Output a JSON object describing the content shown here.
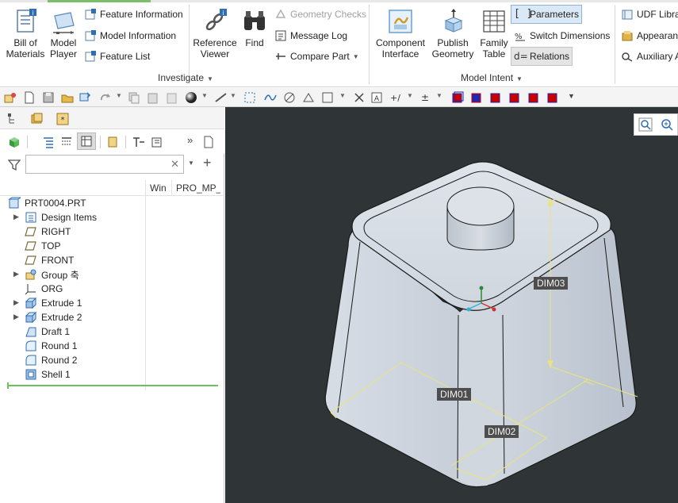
{
  "ribbon": {
    "bom": {
      "line1": "Bill of",
      "line2": "Materials"
    },
    "model_player": {
      "line1": "Model",
      "line2": "Player"
    },
    "feature_information": "Feature Information",
    "model_information": "Model Information",
    "feature_list": "Feature List",
    "reference_viewer": {
      "line1": "Reference",
      "line2": "Viewer"
    },
    "find": "Find",
    "geometry_checks": "Geometry Checks",
    "message_log": "Message Log",
    "compare_part": "Compare Part",
    "investigate_label": "Investigate",
    "component_interface": {
      "line1": "Component",
      "line2": "Interface"
    },
    "publish_geometry": {
      "line1": "Publish",
      "line2": "Geometry"
    },
    "family_table": {
      "line1": "Family",
      "line2": "Table"
    },
    "parameters": "Parameters",
    "switch_dimensions": "Switch Dimensions",
    "relations": "Relations",
    "model_intent_label": "Model Intent",
    "udf_library": "UDF Libra",
    "appearance": "Appearan",
    "auxiliary": "Auxiliary A"
  },
  "panel": {
    "filter_placeholder": "",
    "columns": [
      "Win",
      "PRO_MP_"
    ],
    "tree": [
      {
        "label": "PRT0004.PRT",
        "icon": "part-icon",
        "expandable": false,
        "level": 0
      },
      {
        "label": "Design Items",
        "icon": "design-items-icon",
        "expandable": true,
        "level": 1
      },
      {
        "label": "RIGHT",
        "icon": "datum-plane-icon",
        "expandable": false,
        "level": 1
      },
      {
        "label": "TOP",
        "icon": "datum-plane-icon",
        "expandable": false,
        "level": 1
      },
      {
        "label": "FRONT",
        "icon": "datum-plane-icon",
        "expandable": false,
        "level": 1
      },
      {
        "label": "Group 축",
        "icon": "group-icon",
        "expandable": true,
        "level": 1
      },
      {
        "label": "ORG",
        "icon": "coordinate-system-icon",
        "expandable": false,
        "level": 1
      },
      {
        "label": "Extrude 1",
        "icon": "extrude-icon",
        "expandable": true,
        "level": 1
      },
      {
        "label": "Extrude 2",
        "icon": "extrude-icon",
        "expandable": true,
        "level": 1
      },
      {
        "label": "Draft 1",
        "icon": "draft-icon",
        "expandable": false,
        "level": 1
      },
      {
        "label": "Round 1",
        "icon": "round-icon",
        "expandable": false,
        "level": 1
      },
      {
        "label": "Round 2",
        "icon": "round-icon",
        "expandable": false,
        "level": 1
      },
      {
        "label": "Shell 1",
        "icon": "shell-icon",
        "expandable": false,
        "level": 1
      }
    ]
  },
  "viewport": {
    "dims": [
      "DIM03",
      "DIM01",
      "DIM02"
    ]
  },
  "colors": {
    "viewport_bg": "#2f3436",
    "model_face": "#c9d0d9",
    "dim_line": "#e9e57a",
    "accent": "#7bbf6a"
  }
}
